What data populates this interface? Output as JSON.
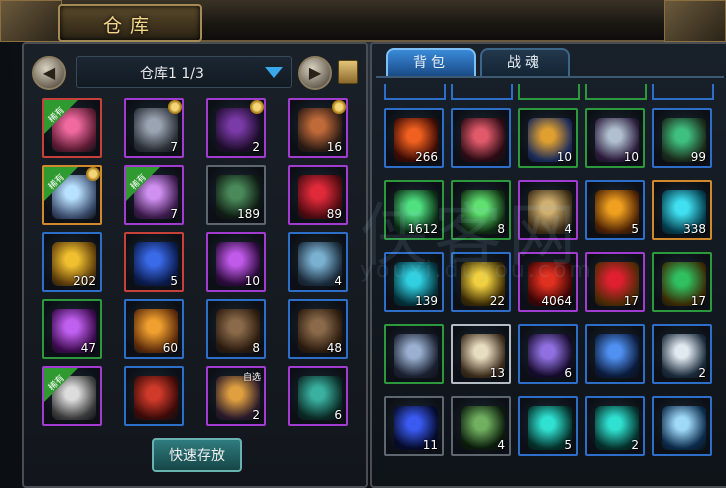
{
  "window": {
    "title": "仓库"
  },
  "warehouse": {
    "prev_symbol": "◀",
    "next_symbol": "▶",
    "bag_label": "仓库1 1/3",
    "quick_store_label": "快速存放",
    "rare_label": "稀有",
    "auto_label": "自选",
    "slots": [
      {
        "border": "red",
        "rare": true,
        "gear": false,
        "count": "",
        "icon": "pink-gem-icon",
        "c1": "#f06aa0",
        "c2": "#5a1a30"
      },
      {
        "border": "purple",
        "rare": false,
        "gear": true,
        "count": "7",
        "icon": "dragon-armor-icon",
        "c1": "#9aa4b2",
        "c2": "#2a2e36"
      },
      {
        "border": "purple",
        "rare": false,
        "gear": true,
        "count": "2",
        "icon": "dark-armor-icon",
        "c1": "#7a3aa8",
        "c2": "#1c0c2a"
      },
      {
        "border": "purple",
        "rare": false,
        "gear": true,
        "count": "16",
        "icon": "dragon-head-icon",
        "c1": "#c06a3a",
        "c2": "#2a1a14"
      },
      {
        "border": "orange",
        "rare": true,
        "gear": true,
        "count": "",
        "icon": "crystal-weapon-icon",
        "c1": "#b8e0ff",
        "c2": "#3a4a6a"
      },
      {
        "border": "purple",
        "rare": true,
        "gear": false,
        "count": "7",
        "icon": "purple-crystal-icon",
        "c1": "#d090f0",
        "c2": "#3a1a4a"
      },
      {
        "border": "gray",
        "rare": false,
        "gear": false,
        "count": "189",
        "icon": "green-swirl-icon",
        "c1": "#4a8a5a",
        "c2": "#0e1a12"
      },
      {
        "border": "purple",
        "rare": false,
        "gear": false,
        "count": "89",
        "icon": "red-gem-icon",
        "c1": "#e02a3a",
        "c2": "#4a0a10"
      },
      {
        "border": "blue",
        "rare": false,
        "gear": false,
        "count": "202",
        "icon": "gold-sand-icon",
        "c1": "#f0c030",
        "c2": "#5a3a0a"
      },
      {
        "border": "red",
        "rare": false,
        "gear": false,
        "count": "5",
        "icon": "blue-orb-icon",
        "c1": "#3a6ae8",
        "c2": "#0a1a4a"
      },
      {
        "border": "purple",
        "rare": false,
        "gear": false,
        "count": "10",
        "icon": "purple-shard-icon",
        "c1": "#c05ae8",
        "c2": "#2a0a3a"
      },
      {
        "border": "blue",
        "rare": false,
        "gear": false,
        "count": "4",
        "icon": "blue-armor-icon",
        "c1": "#7ab0d0",
        "c2": "#1a2a3a"
      },
      {
        "border": "green",
        "rare": false,
        "gear": false,
        "count": "47",
        "icon": "amethyst-cluster-icon",
        "c1": "#c060f0",
        "c2": "#3a0a4a"
      },
      {
        "border": "blue",
        "rare": false,
        "gear": false,
        "count": "60",
        "icon": "amber-crystal-icon",
        "c1": "#f0a030",
        "c2": "#5a2a0a"
      },
      {
        "border": "blue",
        "rare": false,
        "gear": false,
        "count": "8",
        "icon": "bagua-icon",
        "c1": "#8a6a4a",
        "c2": "#2a1a0e"
      },
      {
        "border": "blue",
        "rare": false,
        "gear": false,
        "count": "48",
        "icon": "bagua-icon",
        "c1": "#8a6a4a",
        "c2": "#2a1a0e"
      },
      {
        "border": "purple",
        "rare": true,
        "gear": false,
        "count": "",
        "icon": "white-stone-icon",
        "c1": "#dcdcdc",
        "c2": "#3a3a3a"
      },
      {
        "border": "blue",
        "rare": false,
        "gear": false,
        "count": "",
        "icon": "red-talisman-icon",
        "c1": "#d03a2a",
        "c2": "#3a0a08"
      },
      {
        "border": "purple",
        "rare": false,
        "gear": false,
        "count": "2",
        "icon": "staff-icon",
        "c1": "#e0a040",
        "c2": "#2a1a2a",
        "auto": true
      },
      {
        "border": "purple",
        "rare": false,
        "gear": false,
        "count": "6",
        "icon": "teal-stone-icon",
        "c1": "#3ab0a0",
        "c2": "#0a2a24"
      }
    ]
  },
  "backpack": {
    "tabs": [
      "背包",
      "战魂"
    ],
    "watermark": "侠客网",
    "watermark_sub": "youxi.duyou.com",
    "partial_row_borders": [
      "blue",
      "blue",
      "green",
      "green",
      "blue"
    ],
    "slots": [
      {
        "border": "blue",
        "count": "266",
        "icon": "fire-burst-icon",
        "c1": "#f06020",
        "c2": "#3a0a04"
      },
      {
        "border": "blue",
        "count": "",
        "icon": "red-crystal-icon",
        "c1": "#e05a6a",
        "c2": "#2a0a14"
      },
      {
        "border": "green",
        "count": "10",
        "icon": "gold-potion-icon",
        "c1": "#e0a030",
        "c2": "#1a2a5a"
      },
      {
        "border": "green",
        "count": "10",
        "icon": "silver-potion-icon",
        "c1": "#b0c0d0",
        "c2": "#2a1a3a"
      },
      {
        "border": "blue",
        "count": "99",
        "icon": "jade-pendant-icon",
        "c1": "#40c080",
        "c2": "#1a2a1a"
      },
      {
        "border": "green",
        "count": "1612",
        "icon": "green-potion-icon",
        "c1": "#50e080",
        "c2": "#0a2a14"
      },
      {
        "border": "green",
        "count": "8",
        "icon": "green-bottle-icon",
        "c1": "#60e070",
        "c2": "#0e2a10"
      },
      {
        "border": "purple",
        "count": "4",
        "icon": "scroll-icon",
        "c1": "#d0b070",
        "c2": "#3a2a14"
      },
      {
        "border": "blue",
        "count": "5",
        "icon": "amber-ore-icon",
        "c1": "#f0a020",
        "c2": "#4a2004"
      },
      {
        "border": "orange",
        "count": "338",
        "icon": "cyan-orb-icon",
        "c1": "#40e0f0",
        "c2": "#043a4a"
      },
      {
        "border": "blue",
        "count": "139",
        "icon": "cyan-ring-icon",
        "c1": "#30d0e0",
        "c2": "#04303a"
      },
      {
        "border": "blue",
        "count": "22",
        "icon": "yellow-potion-icon",
        "c1": "#f0d040",
        "c2": "#3a2a04"
      },
      {
        "border": "purple",
        "count": "4064",
        "icon": "blood-seal-icon",
        "c1": "#e03020",
        "c2": "#3a0404"
      },
      {
        "border": "purple",
        "count": "17",
        "icon": "red-pearl-icon",
        "c1": "#e02030",
        "c2": "#4a2a04"
      },
      {
        "border": "green",
        "count": "17",
        "icon": "green-pearl-icon",
        "c1": "#30c060",
        "c2": "#3a2a04"
      },
      {
        "border": "green",
        "count": "",
        "icon": "blue-beads-icon",
        "c1": "#9ab0d0",
        "c2": "#1a2030"
      },
      {
        "border": "white",
        "count": "13",
        "icon": "order-token-icon",
        "c1": "#e8dcc0",
        "c2": "#3a2a1a"
      },
      {
        "border": "blue",
        "count": "6",
        "icon": "violet-crystal-icon",
        "c1": "#9070e0",
        "c2": "#140a2a"
      },
      {
        "border": "blue",
        "count": "",
        "icon": "blue-crystal-icon",
        "c1": "#5090f0",
        "c2": "#0a1a3a"
      },
      {
        "border": "blue",
        "count": "2",
        "icon": "white-crystal-icon",
        "c1": "#e0e8f0",
        "c2": "#1a2a3a"
      },
      {
        "border": "gray",
        "count": "11",
        "icon": "blue-flame-icon",
        "c1": "#3a5af0",
        "c2": "#040a2a"
      },
      {
        "border": "gray",
        "count": "4",
        "icon": "herb-icon",
        "c1": "#70b060",
        "c2": "#0a1a0a"
      },
      {
        "border": "blue",
        "count": "5",
        "icon": "cyan-gem-icon",
        "c1": "#30e0d0",
        "c2": "#04302a"
      },
      {
        "border": "blue",
        "count": "2",
        "icon": "cyan-gem-icon",
        "c1": "#30e0d0",
        "c2": "#04302a"
      },
      {
        "border": "blue",
        "count": "",
        "icon": "ice-crystal-icon",
        "c1": "#a0d8f8",
        "c2": "#0a2a4a"
      }
    ]
  }
}
